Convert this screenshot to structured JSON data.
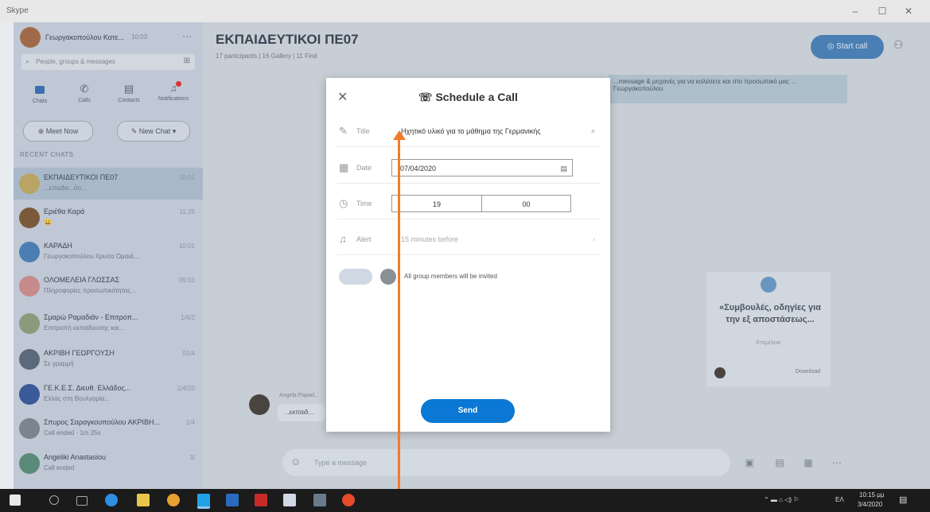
{
  "window": {
    "app_title": "Skype",
    "controls": [
      "–",
      "☐",
      "✕"
    ]
  },
  "sidebar": {
    "profile_name": "Γεωργακοπούλου Κατε...",
    "profile_status": "10:03",
    "more": "···",
    "search_placeholder": "People, groups & messages",
    "nav": [
      {
        "label": "Chats",
        "icon": "chat-icon"
      },
      {
        "label": "Calls",
        "icon": "phone-icon"
      },
      {
        "label": "Contacts",
        "icon": "contacts-icon"
      },
      {
        "label": "Notifications",
        "icon": "bell-icon"
      }
    ],
    "meet_now": "Meet Now",
    "new_chat": "New Chat",
    "recent_label": "RECENT CHATS",
    "chats": [
      {
        "name": "ΕΚΠΑΙΔΕΥΤΙΚΟΙ ΠΕ07",
        "sub": "...επαιδα...ότι...",
        "time": "10:01",
        "color": "#b8a565",
        "active": true
      },
      {
        "name": "Εριέθα Καρά",
        "sub": "😀",
        "time": "11:25",
        "color": "#7a5a3a",
        "active": false
      },
      {
        "name": "ΚΑΡΑΔΗ",
        "sub": "Γεωργακοπούλου Χρυσα Ομαιά...",
        "time": "10:01",
        "color": "#4a7fb3",
        "active": false
      },
      {
        "name": "ΟΛΟΜΕΛΕΙΑ ΓΛΩΣΣΑΣ",
        "sub": "Πληροφορίες προσωπικότητας...",
        "time": "09:01",
        "color": "#c78a8a",
        "active": false
      },
      {
        "name": "Σμαρώ Ραμαδιάν - Επιτροπ...",
        "sub": "Επιτροπή εκπαίδευσης και...",
        "time": "1/4/2",
        "color": "#8a9a7a",
        "active": false
      },
      {
        "name": "ΑΚΡΙΒΗ ΓΕΩΡΓΟΥΣΗ",
        "sub": "Σε γραμμή",
        "time": "01/4",
        "color": "#5a6a7a",
        "active": false
      },
      {
        "name": "ΓΕ.Κ.Ε.Σ. Διευθ. Ελλάδος...",
        "sub": "Ελλάς στη Βουλγαρία...",
        "time": "1/4/20",
        "color": "#3a5a9a",
        "active": false
      },
      {
        "name": "Σπυρος Σαραγκουπούλου ΑΚΡΙΒΗ...",
        "sub": "Call ended · 1m 25s",
        "time": "1/4",
        "color": "#7a8590",
        "active": false
      },
      {
        "name": "Angeliki Anastasiou",
        "sub": "Call ended",
        "time": "3/",
        "color": "#5a8a7a",
        "active": false
      }
    ]
  },
  "main": {
    "title": "ΕΚΠΑΙΔΕΥΤΙΚΟΙ ΠΕ07",
    "subtitle": "17 participants | 16 Gallery | 11 Find",
    "start_call": "Start call",
    "info_text": "...message & μηχανές για να καλέσετε και στο προσωπικό μας ... Γεωργακοπούλου",
    "card_title": "«Συμβουλές, οδηγίες για την εξ αποστάσεως...",
    "card_meta": "Επιμέλεια",
    "card_action": "Download",
    "message_snippet": "...εκπαιδ...",
    "message_author": "Angela Papad...",
    "compose_placeholder": "Type a message"
  },
  "dialog": {
    "title": "Schedule a Call",
    "close": "✕",
    "title_label": "Title",
    "title_value": "Ηχητικό υλικό για το μάθημα της Γερμανικής",
    "date_label": "Date",
    "date_value": "07/04/2020",
    "time_label": "Time",
    "hour": "19",
    "minute": "00",
    "alert_label": "Alert",
    "alert_value": "15 minutes before",
    "members_note": "All group members will be invited",
    "send": "Send"
  },
  "taskbar": {
    "time": "10:15 μμ",
    "date": "3/4/2020",
    "lang": "ΕΛ"
  }
}
